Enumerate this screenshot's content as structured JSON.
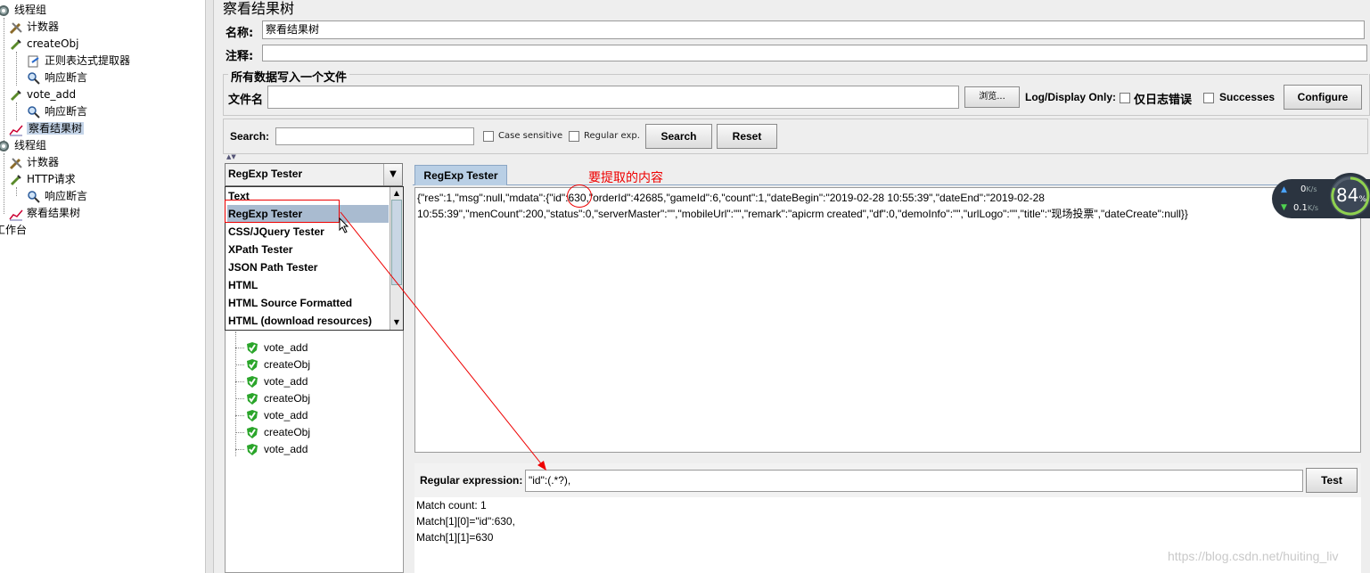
{
  "tree": {
    "items": [
      {
        "label": "线程组",
        "icon": "gear-icon"
      },
      {
        "label": "计数器",
        "icon": "wrench-icon"
      },
      {
        "label": "createObj",
        "icon": "pipette-icon"
      },
      {
        "label": "正则表达式提取器",
        "icon": "extractor-icon"
      },
      {
        "label": "响应断言",
        "icon": "magnifier-icon"
      },
      {
        "label": "vote_add",
        "icon": "pipette-icon"
      },
      {
        "label": "响应断言",
        "icon": "magnifier-icon"
      },
      {
        "label": "察看结果树",
        "icon": "chart-icon"
      },
      {
        "label": "线程组",
        "icon": "gear-icon"
      },
      {
        "label": "计数器",
        "icon": "wrench-icon"
      },
      {
        "label": "HTTP请求",
        "icon": "pipette-icon"
      },
      {
        "label": "响应断言",
        "icon": "magnifier-icon"
      },
      {
        "label": "察看结果树",
        "icon": "chart-icon"
      },
      {
        "label": "工作台",
        "icon": ""
      }
    ]
  },
  "header": {
    "title": "察看结果树",
    "name_label": "名称:",
    "name_value": "察看结果树",
    "comment_label": "注释:"
  },
  "file": {
    "group_title": "所有数据写入一个文件",
    "filename_label": "文件名",
    "browse_label": "浏览...",
    "log_display_label": "Log/Display Only:",
    "errors_only_label": "仅日志错误",
    "successes_label": "Successes",
    "configure_label": "Configure"
  },
  "search": {
    "label": "Search:",
    "case_sensitive_label": "Case sensitive",
    "regular_exp_label": "Regular exp.",
    "search_button": "Search",
    "reset_button": "Reset"
  },
  "renderer": {
    "selected": "RegExp Tester",
    "options": [
      "Text",
      "RegExp Tester",
      "CSS/JQuery Tester",
      "XPath Tester",
      "JSON Path Tester",
      "HTML",
      "HTML Source Formatted",
      "HTML (download resources)"
    ]
  },
  "results": {
    "partial_item": "createObj",
    "items": [
      "vote_add",
      "createObj",
      "vote_add",
      "createObj",
      "vote_add",
      "createObj",
      "vote_add"
    ]
  },
  "tab": {
    "label": "RegExp Tester"
  },
  "annotation": {
    "text": "要提取的内容"
  },
  "response": {
    "line1_pre": "{\"res\":1,\"msg\":null,\"mdata\":{\"",
    "line1_id": "id\":630",
    "line1_post": ",\"orderId\":42685,\"gameId\":6,\"count\":1,\"dateBegin\":\"2019-02-28 10:55:39\",\"dateEnd\":\"2019-02-28",
    "line2": "10:55:39\",\"menCount\":200,\"status\":0,\"serverMaster\":\"\",\"mobileUrl\":\"\",\"remark\":\"apicrm created\",\"df\":0,\"demoInfo\":\"\",\"urlLogo\":\"\",\"title\":\"现场投票\",\"dateCreate\":null}}"
  },
  "regex": {
    "label": "Regular expression:",
    "value": "\"id\":(.*?),",
    "test_button": "Test"
  },
  "match": {
    "lines": [
      "Match count: 1",
      "Match[1][0]=\"id\":630,",
      "Match[1][1]=630"
    ]
  },
  "netwidget": {
    "up_value": "0",
    "up_unit": "K/s",
    "down_value": "0.1",
    "down_unit": "K/s",
    "percent": "84",
    "percent_sign": "%"
  },
  "watermark": "https://blog.csdn.net/huiting_liv"
}
